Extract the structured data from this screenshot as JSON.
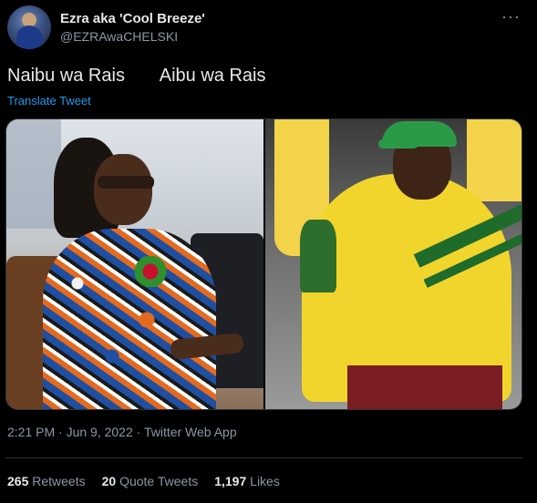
{
  "tweet": {
    "author_name": "Ezra aka 'Cool Breeze'",
    "author_handle": "@EZRAwaCHELSKI",
    "text": "Naibu wa Rais       Aibu wa Rais",
    "translate_label": "Translate Tweet",
    "timestamp": "2:21 PM · Jun 9, 2022 · Twitter Web App"
  },
  "stats": {
    "retweets": {
      "count": "265",
      "label": "Retweets"
    },
    "quote_tweets": {
      "count": "20",
      "label": "Quote Tweets"
    },
    "likes": {
      "count": "1,197",
      "label": "Likes"
    }
  },
  "icons": {
    "more": "more-options-icon"
  },
  "colors": {
    "background": "#000000",
    "text": "#e7e9ea",
    "secondary_text": "#8b98a5",
    "link": "#1d9bf0",
    "divider": "#2f3336"
  }
}
